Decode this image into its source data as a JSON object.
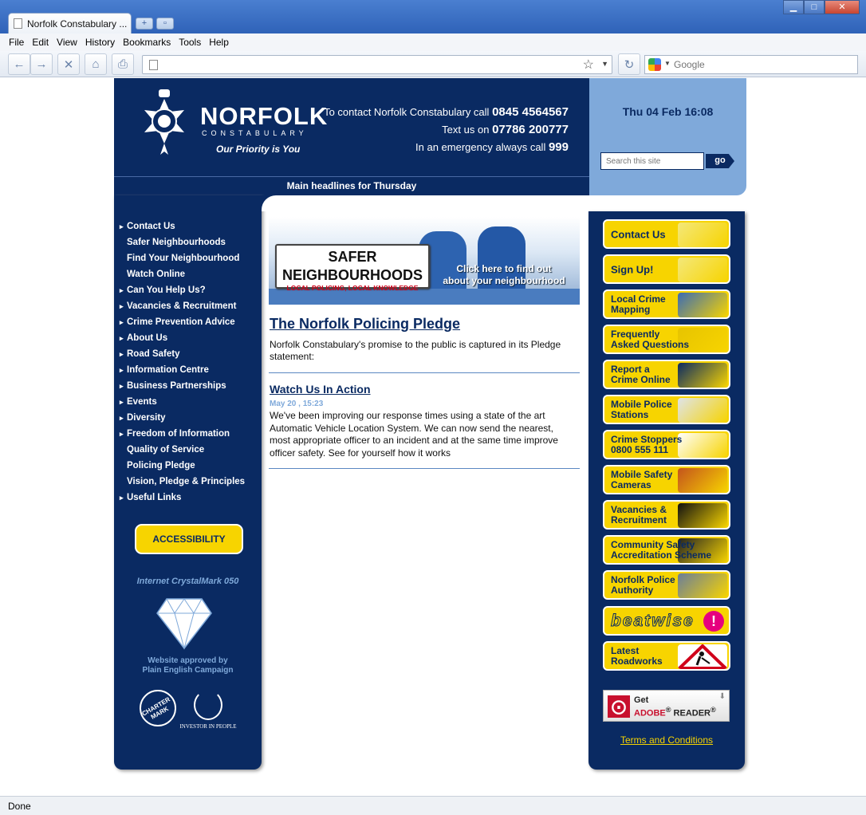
{
  "browser": {
    "tab_title": "Norfolk Constabulary ...",
    "menu": [
      "File",
      "Edit",
      "View",
      "History",
      "Bookmarks",
      "Tools",
      "Help"
    ],
    "search_placeholder": "Google",
    "status": "Done"
  },
  "header": {
    "logo_name": "NORFOLK",
    "logo_sub": "CONSTABULARY",
    "logo_tag": "Our Priority is You",
    "contact_pre": "To contact Norfolk Constabulary call",
    "contact_num": "0845 4564567",
    "text_pre": "Text us on",
    "text_num": "07786 200777",
    "emergency_pre": "In an emergency always call",
    "emergency_num": "999",
    "headlines": "Main headlines for Thursday",
    "datetime": "Thu 04 Feb 16:08",
    "search_placeholder": "Search this site",
    "go": "go"
  },
  "leftnav": {
    "items": [
      {
        "label": "Contact Us",
        "arrow": true
      },
      {
        "label": "Safer Neighbourhoods",
        "arrow": false
      },
      {
        "label": "Find Your Neighbourhood",
        "arrow": false
      },
      {
        "label": "Watch Online",
        "arrow": false
      },
      {
        "label": "Can You Help Us?",
        "arrow": true
      },
      {
        "label": "Vacancies & Recruitment",
        "arrow": true
      },
      {
        "label": "Crime Prevention Advice",
        "arrow": true
      },
      {
        "label": "About Us",
        "arrow": true
      },
      {
        "label": "Road Safety",
        "arrow": true
      },
      {
        "label": "Information Centre",
        "arrow": true
      },
      {
        "label": "Business Partnerships",
        "arrow": true
      },
      {
        "label": "Events",
        "arrow": true
      },
      {
        "label": "Diversity",
        "arrow": true
      },
      {
        "label": "Freedom of Information",
        "arrow": true
      },
      {
        "label": "Quality of Service",
        "arrow": false
      },
      {
        "label": "Policing Pledge",
        "arrow": false
      },
      {
        "label": "Vision, Pledge & Principles",
        "arrow": false
      },
      {
        "label": "Useful Links",
        "arrow": true
      }
    ],
    "accessibility": "ACCESSIBILITY",
    "crystal": "Internet CrystalMark 050",
    "plain_english_1": "Website approved by",
    "plain_english_2": "Plain English Campaign",
    "charter": "CHARTER MARK",
    "iip": "INVESTOR IN PEOPLE"
  },
  "banner": {
    "sign_big_1": "SAFER",
    "sign_big_2": "NEIGHBOURHOODS",
    "sign_small": "LOCAL POLICING, LOCAL KNOWLEDGE",
    "cta_1": "Click here to find out",
    "cta_2": "about your neighbourhood"
  },
  "main": {
    "pledge_title": "The Norfolk Policing Pledge",
    "pledge_text": "Norfolk Constabulary's promise to the public is captured in its Pledge statement:",
    "watch_title": "Watch Us In Action",
    "watch_date": "May 20 , 15:23",
    "watch_text": "We've been improving our response times using a state of the art Automatic Vehicle Location System. We can now send the nearest, most appropriate officer to an incident and at the same time improve officer safety. See for yourself how it works"
  },
  "rightcol": {
    "buttons": [
      {
        "l1": "Contact Us",
        "l2": "",
        "big": true,
        "art": "#f4e87a"
      },
      {
        "l1": "Sign Up!",
        "l2": "",
        "big": true,
        "art": "#f4e87a"
      },
      {
        "l1": "Local Crime",
        "l2": "Mapping",
        "big": false,
        "art": "#3a6bb5"
      },
      {
        "l1": "Frequently",
        "l2": "Asked Questions",
        "big": false,
        "art": "#e7c400"
      },
      {
        "l1": "Report a",
        "l2": "Crime Online",
        "big": false,
        "art": "#0a2a62"
      },
      {
        "l1": "Mobile Police",
        "l2": "Stations",
        "big": false,
        "art": "#dfe4ea"
      },
      {
        "l1": "Crime Stoppers",
        "l2": "0800 555 111",
        "big": false,
        "art": "#ffffff"
      },
      {
        "l1": "Mobile Safety",
        "l2": "Cameras",
        "big": false,
        "art": "#c4541c"
      },
      {
        "l1": "Vacancies &",
        "l2": "Recruitment",
        "big": false,
        "art": "#111111"
      },
      {
        "l1": "Community Safety",
        "l2": "Accreditation Scheme",
        "big": false,
        "art": "#222222"
      },
      {
        "l1": "Norfolk Police",
        "l2": "Authority",
        "big": false,
        "art": "#6b7e9a"
      }
    ],
    "beatwise": "beatwise",
    "beatwise_mark": "!",
    "roadworks_1": "Latest",
    "roadworks_2": "Roadworks",
    "adobe_get": "Get",
    "adobe_name": "ADOBE",
    "adobe_reader": "READER",
    "terms": "Terms and Conditions"
  },
  "colors": {
    "navy": "#0a2a62",
    "light_blue": "#7fa9da",
    "yellow": "#f7d400"
  }
}
